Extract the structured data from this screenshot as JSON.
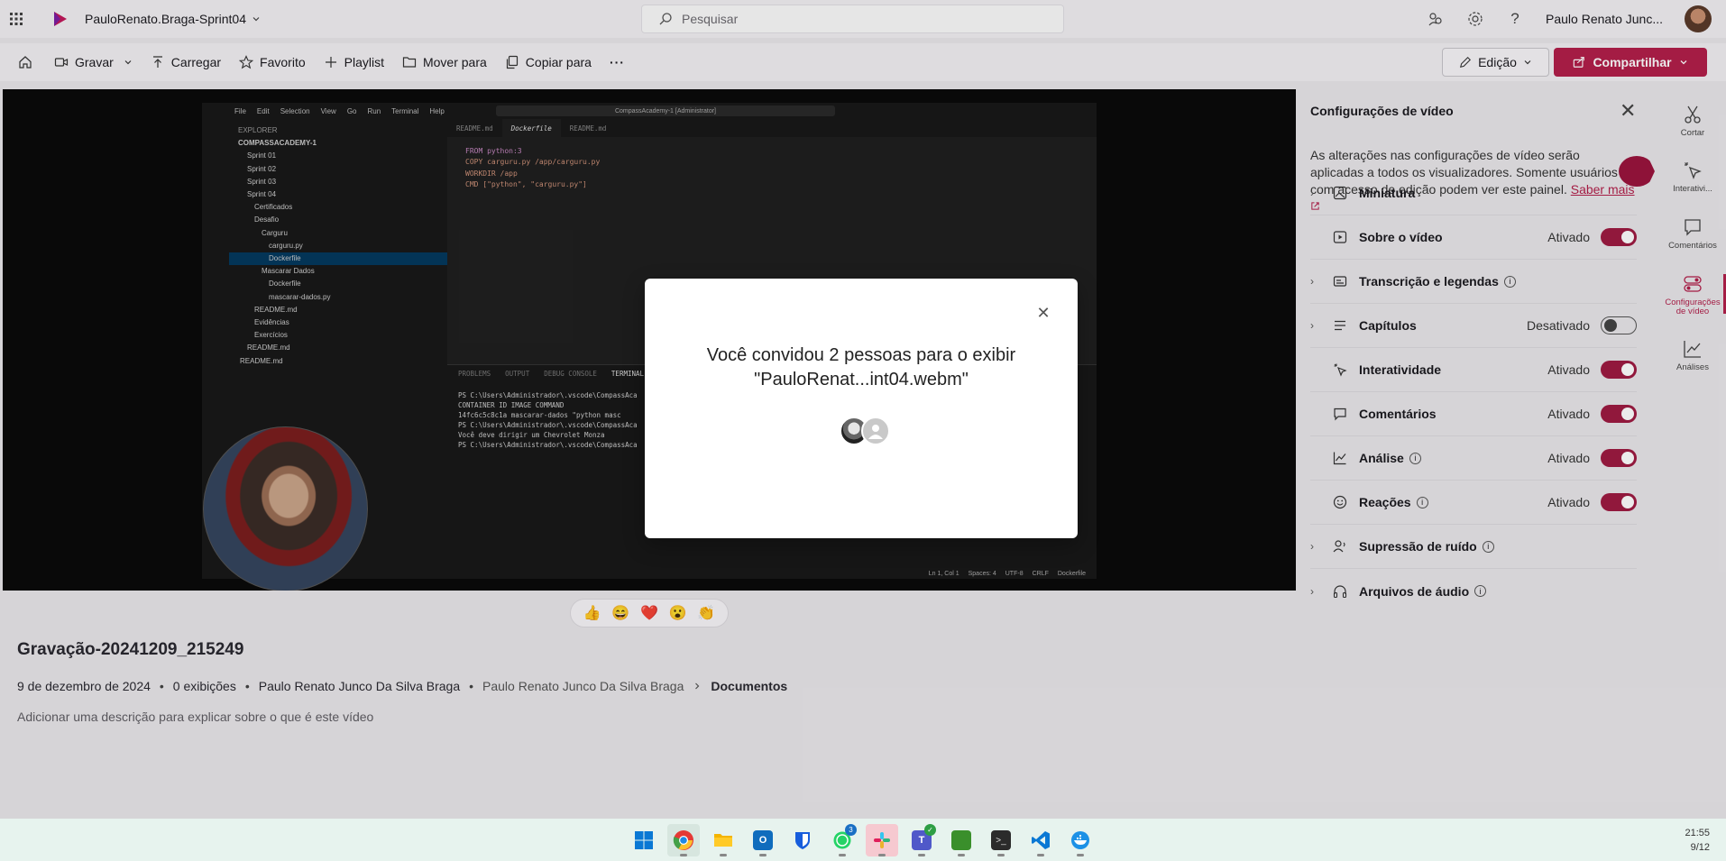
{
  "topbar": {
    "app_title": "PauloRenato.Braga-Sprint04",
    "search_placeholder": "Pesquisar",
    "user_name": "Paulo Renato Junc..."
  },
  "commands": {
    "record": "Gravar",
    "upload": "Carregar",
    "favorite": "Favorito",
    "playlist": "Playlist",
    "move_to": "Mover para",
    "copy_to": "Copiar para",
    "more": "···",
    "edit": "Edição",
    "share": "Compartilhar"
  },
  "vscode": {
    "menu": [
      "File",
      "Edit",
      "Selection",
      "View",
      "Go",
      "Run",
      "Terminal",
      "Help"
    ],
    "search": "CompassAcademy-1 [Administrator]",
    "explorer_title": "EXPLORER",
    "tree": [
      "COMPASSACADEMY-1",
      "Sprint 01",
      "Sprint 02",
      "Sprint 03",
      "Sprint 04",
      "Certificados",
      "Desafio",
      "Carguru",
      "carguru.py",
      "Dockerfile",
      "Mascarar Dados",
      "Dockerfile",
      "mascarar-dados.py",
      "README.md",
      "Evidências",
      "Exercícios",
      "README.md",
      "README.md"
    ],
    "tabs": [
      "README.md",
      "Dockerfile",
      "README.md"
    ],
    "code": [
      "FROM python:3",
      "",
      "COPY carguru.py /app/carguru.py",
      "",
      "WORKDIR /app",
      "",
      "CMD [\"python\", \"carguru.py\"]"
    ],
    "terminal_tabs": [
      "PROBLEMS",
      "OUTPUT",
      "DEBUG CONSOLE",
      "TERMINAL"
    ],
    "terminal": [
      "PS C:\\Users\\Administrador\\.vscode\\CompassAca",
      "CONTAINER ID   IMAGE            COMMAND",
      "14fc6c5c8c1a   mascarar-dados   \"python masc",
      "PS C:\\Users\\Administrador\\.vscode\\CompassAca",
      "Você deve dirigir um Chevrolet Monza",
      "PS C:\\Users\\Administrador\\.vscode\\CompassAca"
    ],
    "status": [
      "Ln 1, Col 1",
      "Spaces: 4",
      "UTF-8",
      "CRLF",
      "Dockerfile"
    ]
  },
  "dialog": {
    "line1": "Você convidou 2 pessoas para o exibir",
    "line2": "\"PauloRenat...int04.webm\""
  },
  "reactions": [
    "👍",
    "😄",
    "❤️",
    "😮",
    "👏"
  ],
  "video": {
    "title": "Gravação-20241209_215249",
    "date": "9 de dezembro de 2024",
    "views": "0 exibições",
    "owner": "Paulo Renato Junco Da Silva Braga",
    "location_owner": "Paulo Renato Junco Da Silva Braga",
    "location_folder": "Documentos",
    "description_placeholder": "Adicionar uma descrição para explicar sobre o que é este vídeo"
  },
  "panel": {
    "title": "Configurações de vídeo",
    "note": "As alterações nas configurações de vídeo serão aplicadas a todos os visualizadores. Somente usuários com acesso de edição podem ver este painel.",
    "learn_more": "Saber mais",
    "rows": [
      {
        "label": "Miniatura",
        "state": "",
        "toggle": "none",
        "expand": true,
        "info": false
      },
      {
        "label": "Sobre o vídeo",
        "state": "Ativado",
        "toggle": "on",
        "expand": false,
        "info": false
      },
      {
        "label": "Transcrição e legendas",
        "state": "",
        "toggle": "none",
        "expand": true,
        "info": true
      },
      {
        "label": "Capítulos",
        "state": "Desativado",
        "toggle": "off",
        "expand": true,
        "info": false
      },
      {
        "label": "Interatividade",
        "state": "Ativado",
        "toggle": "on",
        "expand": false,
        "info": false
      },
      {
        "label": "Comentários",
        "state": "Ativado",
        "toggle": "on",
        "expand": false,
        "info": false
      },
      {
        "label": "Análise",
        "state": "Ativado",
        "toggle": "on",
        "expand": false,
        "info": true
      },
      {
        "label": "Reações",
        "state": "Ativado",
        "toggle": "on",
        "expand": false,
        "info": true
      },
      {
        "label": "Supressão de ruído",
        "state": "",
        "toggle": "none",
        "expand": true,
        "info": true
      },
      {
        "label": "Arquivos de áudio",
        "state": "",
        "toggle": "none",
        "expand": true,
        "info": true
      }
    ]
  },
  "rail": {
    "cut": "Cortar",
    "interactive": "Interativi...",
    "comments": "Comentários",
    "settings_1": "Configurações",
    "settings_2": "de vídeo",
    "analytics": "Análises"
  },
  "taskbar": {
    "time": "21:55",
    "date": "9/12",
    "whatsapp_badge": "3"
  },
  "colors": {
    "accent": "#b21f4a",
    "toggle_on": "#9e1b42"
  }
}
